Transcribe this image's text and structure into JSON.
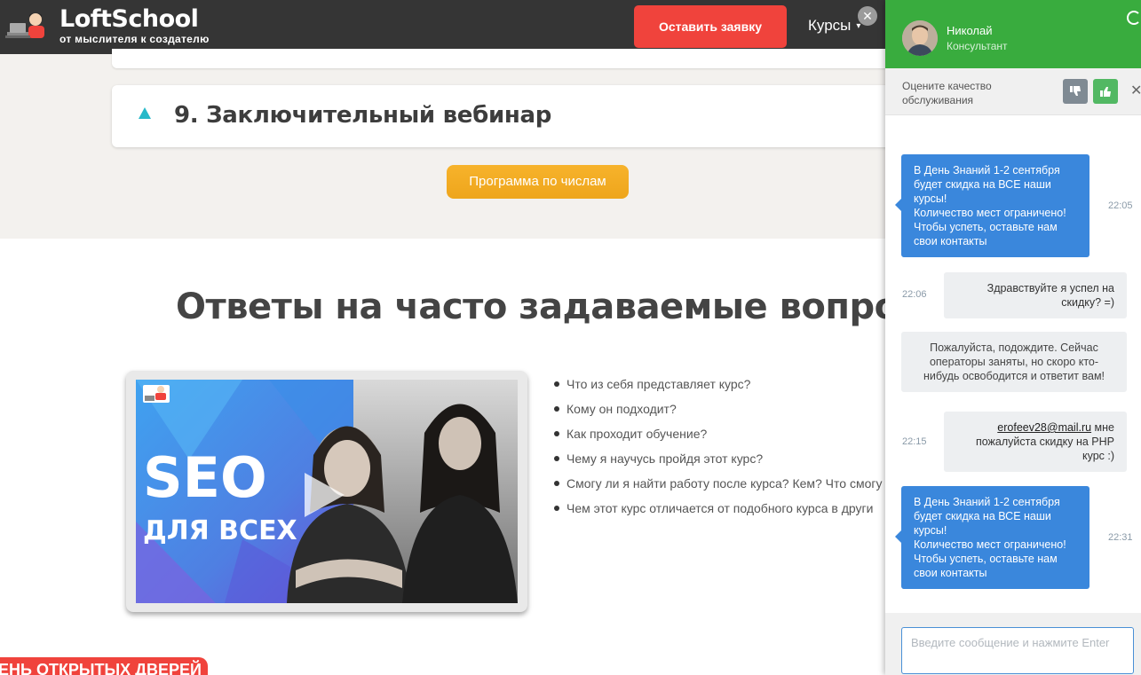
{
  "header": {
    "logo_title": "LoftSchool",
    "logo_tagline": "от мыслителя к создателю",
    "cta_label": "Оставить заявку",
    "courses_label": "Курсы",
    "courses_caret": "▾"
  },
  "program": {
    "accordion_title": "9. Заключительный вебинар",
    "button_label": "Программа по числам"
  },
  "faq": {
    "title": "Ответы на часто задаваемые вопросы",
    "video": {
      "title_line1": "SEO",
      "title_line2": "ДЛЯ ВСЕХ"
    },
    "questions": [
      "Что из себя представляет курс?",
      "Кому он подходит?",
      "Как проходит обучение?",
      "Чему я научусь пройдя этот курс?",
      "Смогу ли я найти работу после курса? Кем? Что смогу",
      "Чем этот курс отличается от подобного курса в други"
    ]
  },
  "banner": {
    "open_days_label": "ЕНЬ ОТКРЫТЫХ ДВЕРЕЙ"
  },
  "chat": {
    "close_glyph": "✕",
    "operator_name": "Николай",
    "operator_role": "Консультант",
    "rate_text": "Оцените качество обслуживания",
    "rate_close_glyph": "✕",
    "messages": [
      {
        "type": "in",
        "text": "В День Знаний 1-2 сентября будет скидка на ВСЕ наши курсы!\nКоличество мест ограничено!\nЧтобы успеть, оставьте нам свои контакты",
        "time": "22:05"
      },
      {
        "type": "out",
        "text": "Здравствуйте я успел на скидку? =)",
        "time": "22:06"
      },
      {
        "type": "sys",
        "text": "Пожалуйста, подождите. Сейчас операторы заняты, но скоро кто-нибудь освободится и ответит вам!"
      },
      {
        "type": "out",
        "email": "erofeev28@mail.ru",
        "text": " мне пожалуйста скидку на PHP курс :)",
        "time": "22:15"
      },
      {
        "type": "in",
        "text": "В День Знаний 1-2 сентября будет скидка на ВСЕ наши курсы!\nКоличество мест ограничено!\nЧтобы успеть, оставьте нам свои контакты",
        "time": "22:31"
      }
    ],
    "input_placeholder": "Введите сообщение и нажмите Enter",
    "input_value": ""
  }
}
